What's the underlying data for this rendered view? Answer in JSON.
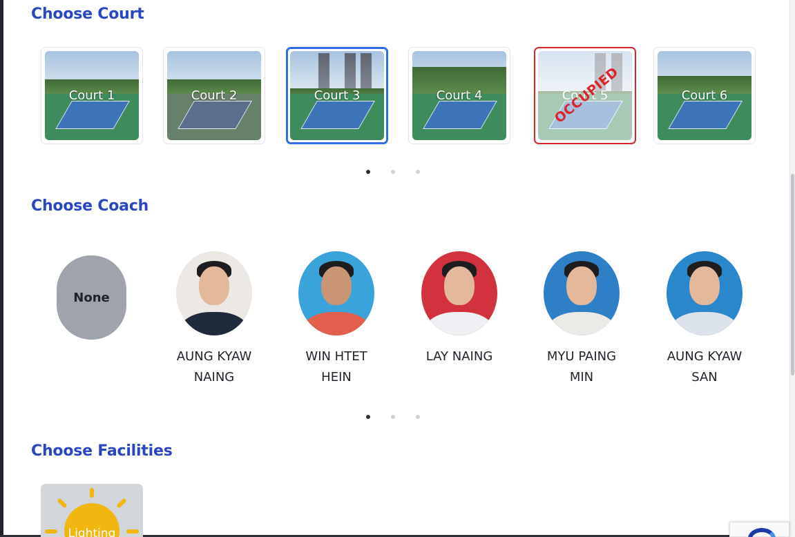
{
  "sections": {
    "court_title": "Choose Court",
    "coach_title": "Choose Coach",
    "facility_title": "Choose Facilities"
  },
  "courts": [
    {
      "label": "Court 1",
      "state": "available"
    },
    {
      "label": "Court 2",
      "state": "available"
    },
    {
      "label": "Court 3",
      "state": "selected"
    },
    {
      "label": "Court 4",
      "state": "available"
    },
    {
      "label": "Court 5",
      "state": "occupied"
    },
    {
      "label": "Court 6",
      "state": "available"
    }
  ],
  "occupied_stamp": "OCCUPIED",
  "court_carousel": {
    "pages": 3,
    "active_page": 1
  },
  "coaches": {
    "none_label": "None",
    "items": [
      {
        "name_line1": "AUNG KYAW",
        "name_line2": "NAING",
        "background": "#e8e5e0"
      },
      {
        "name_line1": "WIN HTET",
        "name_line2": "HEIN",
        "background": "#3aa3d9"
      },
      {
        "name_line1": "LAY NAING",
        "name_line2": "",
        "background": "#d1323d"
      },
      {
        "name_line1": "MYU PAING",
        "name_line2": "MIN",
        "background": "#2f7fc6"
      },
      {
        "name_line1": "AUNG KYAW",
        "name_line2": "SAN",
        "background": "#2a87cc"
      }
    ]
  },
  "coach_carousel": {
    "pages": 3,
    "active_page": 1
  },
  "facilities": [
    {
      "label": "Lighting",
      "icon": "sun-icon"
    }
  ],
  "colors": {
    "title": "#2b47c0",
    "selected_border": "#2f6fe6",
    "occupied": "#d8262b",
    "none_pill": "#9ea3ac"
  }
}
